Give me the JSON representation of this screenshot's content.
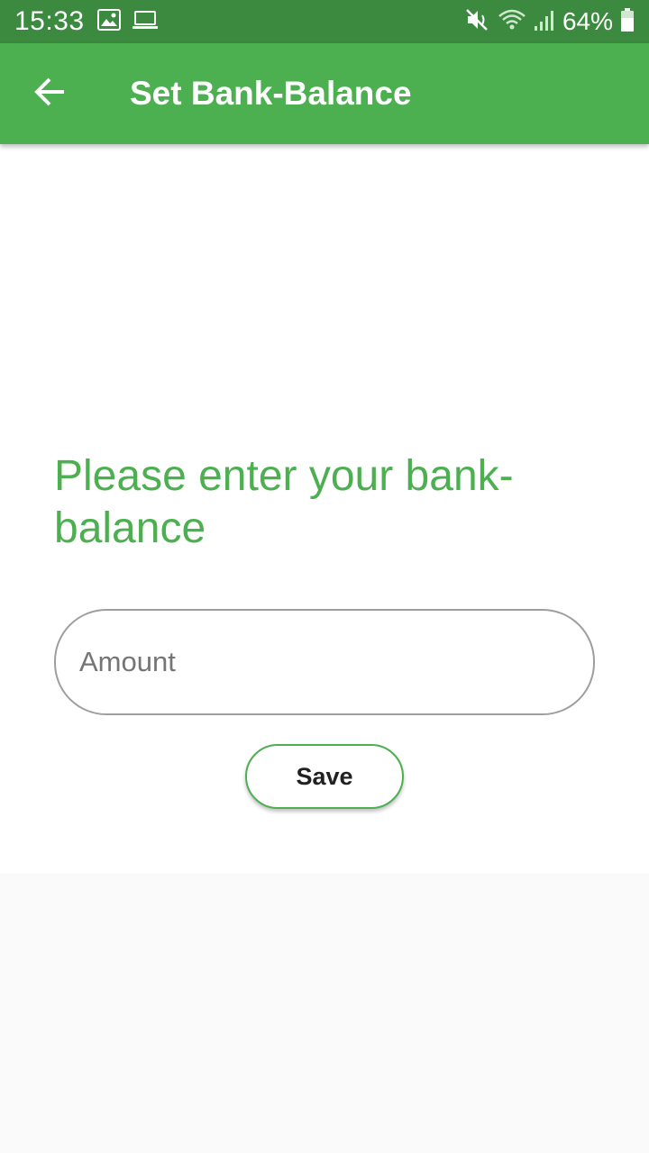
{
  "status_bar": {
    "time": "15:33",
    "battery_percent": "64%",
    "icons": [
      "image-icon",
      "laptop-icon",
      "mute-icon",
      "wifi-icon",
      "signal-icon",
      "battery-icon"
    ]
  },
  "app_bar": {
    "title": "Set Bank-Balance",
    "back_icon": "arrow-back-icon"
  },
  "form": {
    "prompt": "Please enter your bank-balance",
    "amount_placeholder": "Amount",
    "amount_value": "",
    "save_label": "Save"
  },
  "colors": {
    "primary": "#4caf50",
    "status_bar": "#3b8a3f",
    "field_border": "#9e9e9e",
    "background": "#fafafa"
  }
}
